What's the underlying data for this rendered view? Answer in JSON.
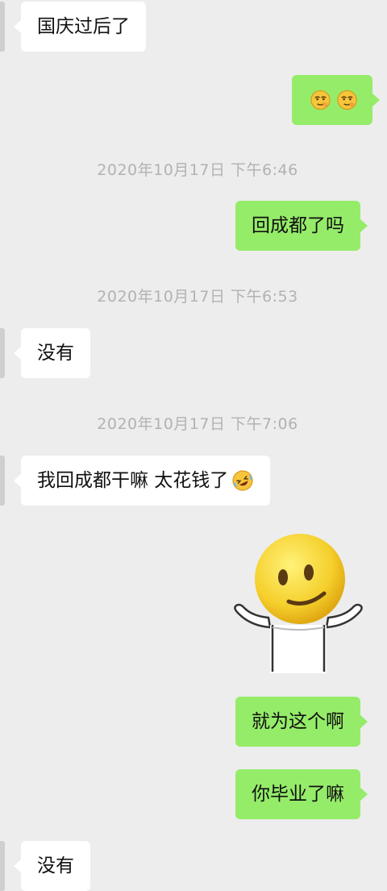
{
  "messages": [
    {
      "direction": "incoming",
      "text": "国庆过后了"
    },
    {
      "direction": "outgoing",
      "emoji": [
        "smirk-face",
        "smirk-face"
      ]
    },
    {
      "timestamp": "2020年10月17日 下午6:46"
    },
    {
      "direction": "outgoing",
      "text": "回成都了吗"
    },
    {
      "timestamp": "2020年10月17日 下午6:53"
    },
    {
      "direction": "incoming",
      "text": "没有"
    },
    {
      "timestamp": "2020年10月17日 下午7:06"
    },
    {
      "direction": "incoming",
      "text": "我回成都干嘛 太花钱了",
      "emoji": "rofl-face"
    },
    {
      "direction": "outgoing",
      "sticker": "smiley-shrug-sticker"
    },
    {
      "direction": "outgoing",
      "text": "就为这个啊"
    },
    {
      "direction": "outgoing",
      "text": "你毕业了嘛"
    },
    {
      "direction": "incoming",
      "text": "没有"
    }
  ],
  "colors": {
    "background": "#ededed",
    "incoming_bubble": "#ffffff",
    "outgoing_bubble": "#95ec69",
    "timestamp_text": "#b2b2b2"
  }
}
